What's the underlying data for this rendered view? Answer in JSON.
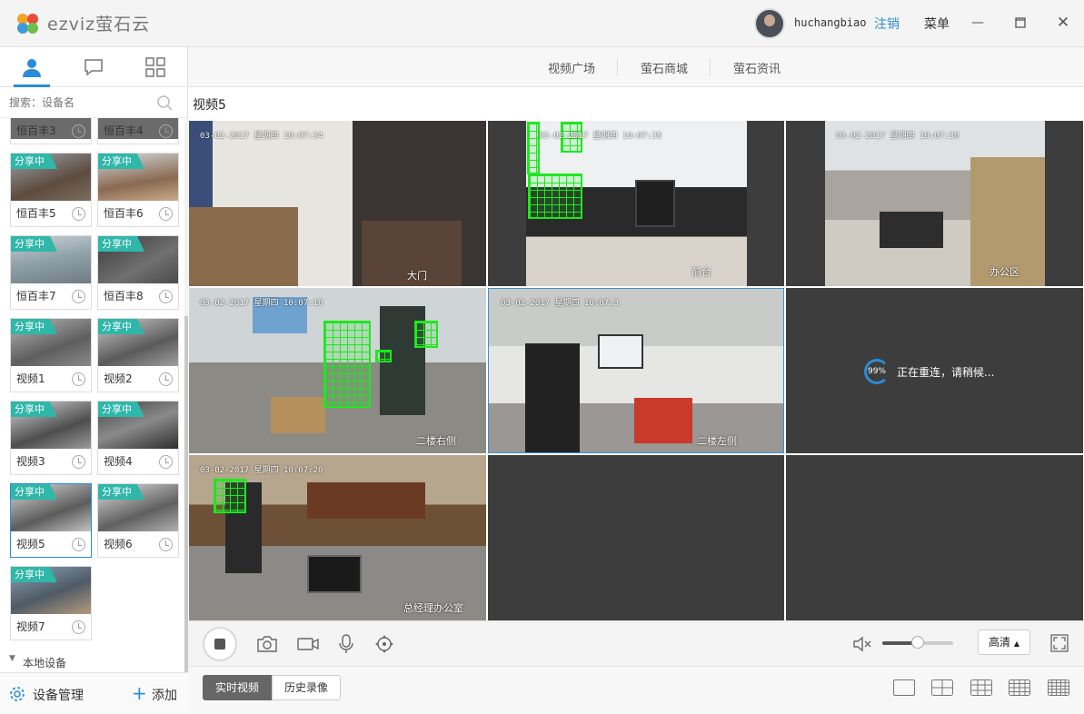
{
  "app": {
    "brand": "ezviz萤石云",
    "username": "huchangbiao",
    "logout_label": "注销",
    "menu_label": "菜单",
    "window_controls": [
      "minimize-icon",
      "maximize-icon",
      "close-icon"
    ]
  },
  "sidebar": {
    "tabs": [
      "person-icon",
      "chat-bubble-icon",
      "grid-apps-icon"
    ],
    "active_tab": "person-icon",
    "search_placeholder": "搜索：设备名",
    "share_badge": "分享中",
    "devices": [
      {
        "name": "恒百丰3",
        "shared": false
      },
      {
        "name": "恒百丰4",
        "shared": false
      },
      {
        "name": "恒百丰5",
        "shared": true
      },
      {
        "name": "恒百丰6",
        "shared": true
      },
      {
        "name": "恒百丰7",
        "shared": true
      },
      {
        "name": "恒百丰8",
        "shared": true
      },
      {
        "name": "视频1",
        "shared": true
      },
      {
        "name": "视频2",
        "shared": true
      },
      {
        "name": "视频3",
        "shared": true
      },
      {
        "name": "视频4",
        "shared": true
      },
      {
        "name": "视频5",
        "shared": true,
        "selected": true
      },
      {
        "name": "视频6",
        "shared": true
      },
      {
        "name": "视频7",
        "shared": true
      }
    ],
    "local_devices_label": "本地设备",
    "device_manage_label": "设备管理",
    "add_label": "添加"
  },
  "topnav": {
    "items": [
      "视频广场",
      "萤石商城",
      "萤石资讯"
    ]
  },
  "view": {
    "title": "视频5",
    "cells": [
      {
        "timestamp": "03-02-2017 星期四 10:07:34",
        "label": "大门"
      },
      {
        "timestamp": "03-02-2017 星期四 10:07:35",
        "label": "前台"
      },
      {
        "timestamp": "03-02-2017 星期四 10:07:30",
        "label": "办公区"
      },
      {
        "timestamp": "03-02-2017 星期四 10:07:10",
        "label": "二楼右侧"
      },
      {
        "timestamp": "03-02-2017 星期四 10:07:3",
        "label": "二楼左侧"
      },
      {
        "reconnect_percent": "99%",
        "reconnect_text": "正在重连，请稍候..."
      },
      {
        "timestamp": "03-02-2017 星期四 10:07:20",
        "label": "总经理办公室"
      },
      {},
      {}
    ]
  },
  "controls": {
    "quality_label": "高清",
    "volume_level": 0.5,
    "icons": [
      "stop-icon",
      "camera-icon",
      "video-record-icon",
      "microphone-icon",
      "ptz-icon",
      "mute-icon",
      "fullscreen-icon"
    ]
  },
  "bottom": {
    "live_label": "实时视频",
    "history_label": "历史录像",
    "layouts": [
      "layout-1-icon",
      "layout-4-icon",
      "layout-9-icon",
      "layout-16-icon",
      "layout-25-icon"
    ]
  },
  "colors": {
    "accent": "#2a8cd8",
    "share_badge": "#2fb7a9",
    "motion": "#1ee81e",
    "empty_cell": "#3d3d3d"
  }
}
